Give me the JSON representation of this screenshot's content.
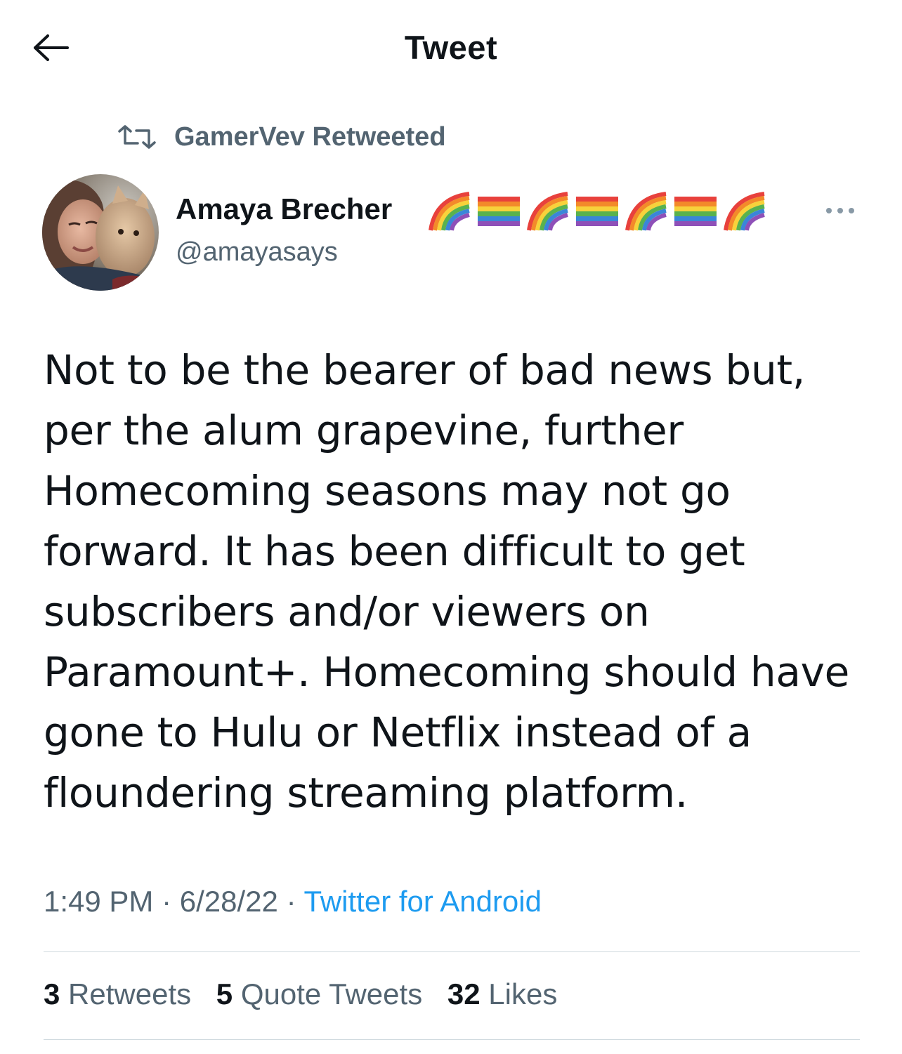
{
  "header": {
    "title": "Tweet",
    "back_icon": "arrow-left-icon"
  },
  "social_context": {
    "icon": "retweet-icon",
    "text": "GamerVev Retweeted"
  },
  "author": {
    "name": "Amaya Brecher",
    "handle": "@amayasays",
    "name_emojis": [
      "rainbow",
      "rainbow-flag",
      "rainbow",
      "rainbow-flag",
      "rainbow",
      "rainbow-flag",
      "rainbow"
    ]
  },
  "tweet": {
    "text": "Not to be the bearer of bad news but,\nper the alum grapevine, further\nHomecoming seasons may not go\nforward. It has been difficult to get\nsubscribers and/or viewers on\nParamount+. Homecoming should have\ngone to Hulu or Netflix instead of a\nfloundering streaming platform.",
    "time": "1:49 PM",
    "date": "6/28/22",
    "separator": "·",
    "source": "Twitter for Android"
  },
  "stats": {
    "retweets_count": "3",
    "retweets_label": "Retweets",
    "quotes_count": "5",
    "quotes_label": "Quote Tweets",
    "likes_count": "32",
    "likes_label": "Likes"
  },
  "colors": {
    "text": "#0f1419",
    "secondary": "#536471",
    "link": "#1d9bf0",
    "divider": "#cfd9de"
  }
}
